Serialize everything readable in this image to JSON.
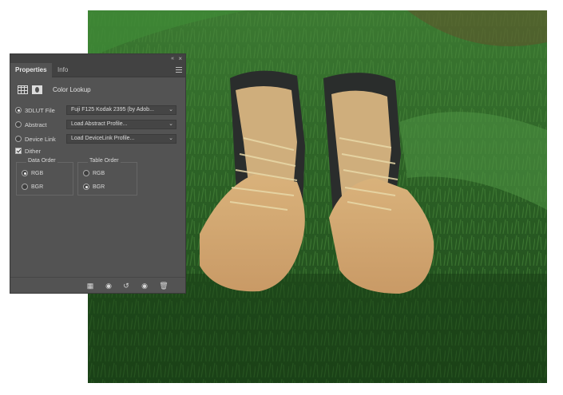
{
  "panel": {
    "tabs": [
      "Properties",
      "Info"
    ],
    "collapse_glyph": "«",
    "close_glyph": "×",
    "adjustment_title": "Color Lookup",
    "icons": [
      "grid-icon",
      "mask-icon"
    ]
  },
  "lookup": {
    "rows": [
      {
        "label": "3DLUT File",
        "value": "Fuji F125 Kodak 2395 (by Adob...",
        "selected": true
      },
      {
        "label": "Abstract",
        "value": "Load Abstract Profile...",
        "selected": false
      },
      {
        "label": "Device Link",
        "value": "Load DeviceLink Profile...",
        "selected": false
      }
    ],
    "dither_label": "Dither",
    "dither_checked": true
  },
  "data_order": {
    "title": "Data Order",
    "options": [
      "RGB",
      "BGR"
    ],
    "selected": "RGB"
  },
  "table_order": {
    "title": "Table Order",
    "options": [
      "RGB",
      "BGR"
    ],
    "selected": "BGR"
  },
  "footer_icons": [
    "clip-to-layer-icon",
    "view-previous-state-icon",
    "reset-icon",
    "visibility-eye-icon",
    "trash-icon"
  ],
  "colors": {
    "panel_bg": "#535353",
    "panel_header": "#424242",
    "grass": "#2f6a2a"
  }
}
